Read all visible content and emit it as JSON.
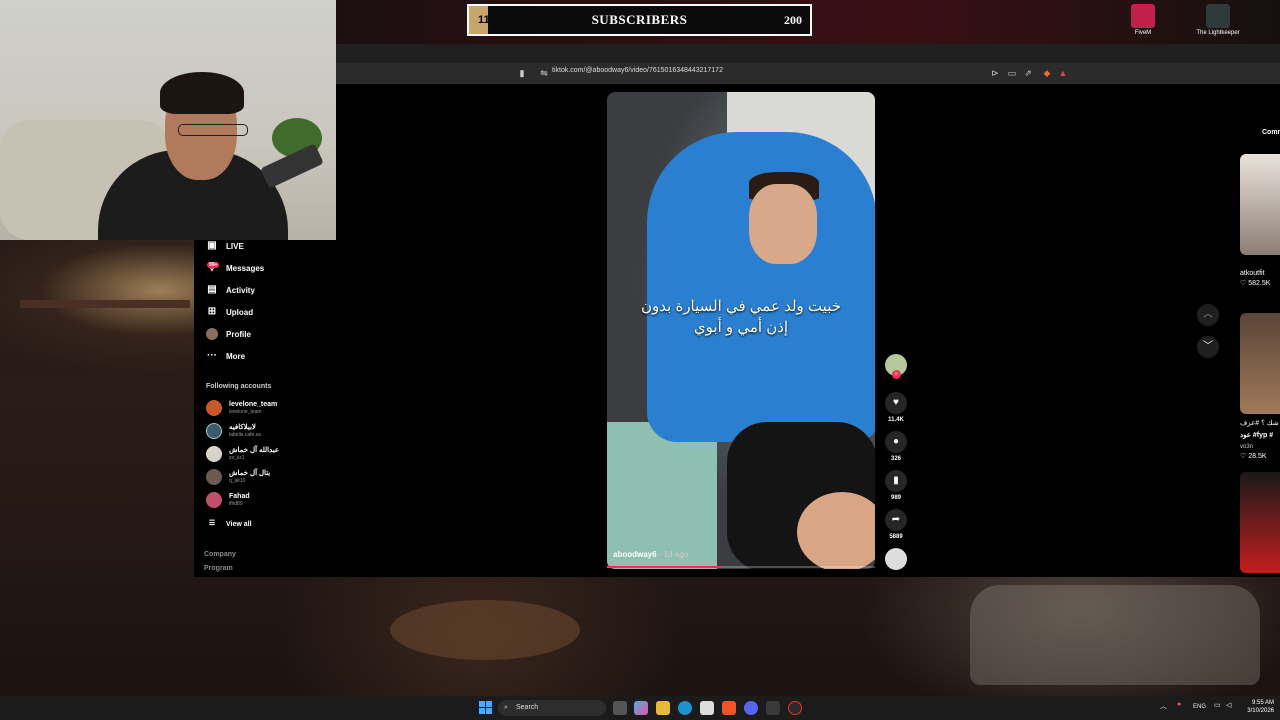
{
  "overlay": {
    "subscriber_goal": {
      "current": "11",
      "title": "SUBSCRIBERS",
      "target": "200",
      "fill_fraction": 0.055
    }
  },
  "desktop_icons": [
    {
      "label": "FiveM",
      "icon": "fivem-icon"
    },
    {
      "label": "The Lightkeeper",
      "icon": "game-icon"
    }
  ],
  "browser": {
    "url": "tiktok.com/@aboodway6/video/7615016348443217172"
  },
  "sidebar": {
    "items": [
      {
        "label": "LIVE",
        "icon": "live-icon"
      },
      {
        "label": "Messages",
        "icon": "messages-icon",
        "badge": "99+"
      },
      {
        "label": "Activity",
        "icon": "activity-icon"
      },
      {
        "label": "Upload",
        "icon": "upload-icon"
      },
      {
        "label": "Profile",
        "icon": "avatar"
      },
      {
        "label": "More",
        "icon": "more-icon"
      }
    ],
    "following_title": "Following accounts",
    "following": [
      {
        "name": "levelone_team",
        "handle": "levelone_team"
      },
      {
        "name": "لابيلاكافيه",
        "handle": "labella.cafe.sa"
      },
      {
        "name": "عبدالله آل خماش",
        "handle": "zx_sz1"
      },
      {
        "name": "بتال آل خماش",
        "handle": "q_ak10"
      },
      {
        "name": "Fahad",
        "handle": "ifhd89"
      }
    ],
    "view_all": "View all",
    "footer": [
      "Company",
      "Program"
    ]
  },
  "video": {
    "caption_line1": "خبيت ولد عمي في السيارة بدون",
    "caption_line2": "إذن أمي و أبوي",
    "author": "aboodway6",
    "ago": " · 1d ago",
    "progress": 0.43
  },
  "actions": {
    "likes": "11.4K",
    "comments": "326",
    "saves": "989",
    "shares": "5889"
  },
  "right_column": {
    "header": "Comm",
    "items": [
      {
        "name": "atkoutfit",
        "views": "582.5K"
      },
      {
        "line1": "شك ؟ #عزف",
        "line2": "عود #fyp #",
        "name": "vo3n",
        "views": "28.5K"
      }
    ]
  },
  "taskbar": {
    "search_placeholder": "Search",
    "language": "ENG",
    "time": "9:55 AM",
    "date": "3/10/2026"
  },
  "colors": {
    "accent": "#fe2c55",
    "goal_fill": "#c8a56a",
    "hoodie": "#2a7fd0"
  }
}
